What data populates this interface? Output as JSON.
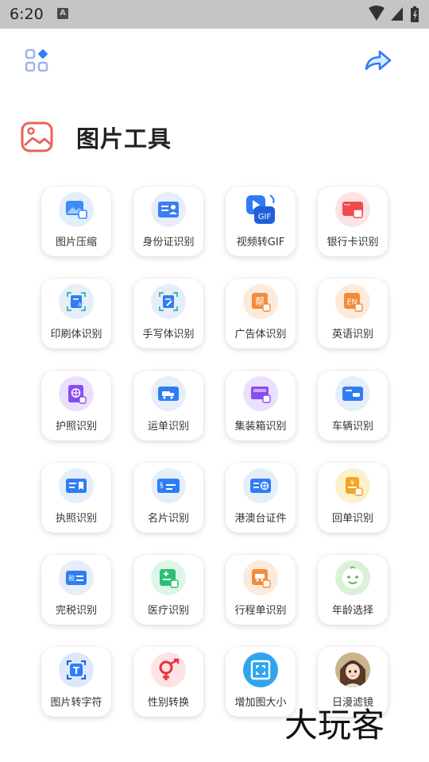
{
  "status_bar": {
    "time": "6:20",
    "notif_icon": "A"
  },
  "toolbar": {
    "left_icon": "apps-icon",
    "right_icon": "share-icon"
  },
  "header": {
    "title": "图片工具",
    "icon": "image-icon"
  },
  "tools": [
    {
      "label": "图片压缩"
    },
    {
      "label": "身份证识别"
    },
    {
      "label": "视频转GIF",
      "badge": "GIF"
    },
    {
      "label": "银行卡识别"
    },
    {
      "label": "印刷体识别"
    },
    {
      "label": "手写体识别"
    },
    {
      "label": "广告体识别",
      "badge": "帮"
    },
    {
      "label": "英语识别",
      "badge": "EN"
    },
    {
      "label": "护照识别"
    },
    {
      "label": "运单识别"
    },
    {
      "label": "集装箱识别"
    },
    {
      "label": "车辆识别"
    },
    {
      "label": "执照识别"
    },
    {
      "label": "名片识别"
    },
    {
      "label": "港澳台证件"
    },
    {
      "label": "回单识别",
      "badge": "¥"
    },
    {
      "label": "完税识别",
      "badge": "税"
    },
    {
      "label": "医疗识别"
    },
    {
      "label": "行程单识别"
    },
    {
      "label": "年龄选择"
    },
    {
      "label": "图片转字符",
      "badge": "T"
    },
    {
      "label": "性别转换"
    },
    {
      "label": "增加图大小"
    },
    {
      "label": "日漫滤镜"
    }
  ],
  "watermark": "大玩客",
  "colors": {
    "status_bar": "#c5c5c5",
    "header_icon": "#e8625a",
    "accent_blue": "#2f7df6"
  }
}
